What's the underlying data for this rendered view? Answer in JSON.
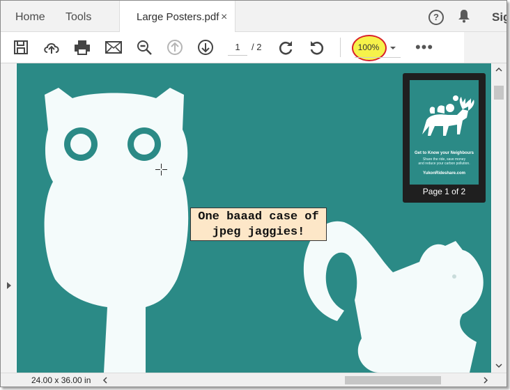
{
  "tabs": {
    "home": "Home",
    "tools": "Tools",
    "document": "Large Posters.pdf",
    "close_symbol": "×"
  },
  "header_right": {
    "help_symbol": "?",
    "signin_partial": "Sig"
  },
  "toolbar": {
    "page_current": "1",
    "page_total": "/ 2",
    "zoom": "100%",
    "more_symbol": "•••"
  },
  "thumbnail": {
    "headline": "Get to Know your Neighbours",
    "sub1": "Share the ride, save money",
    "sub2": "and reduce your carbon pollution.",
    "url": "YukonRideshare.com",
    "label": "Page 1 of 2"
  },
  "annotation": {
    "line1": "One baaad case of",
    "line2": "jpeg jaggies!"
  },
  "status": {
    "dimensions": "24.00 x 36.00 in"
  },
  "colors": {
    "poster_teal": "#2b8a86",
    "zoom_highlight": "#f6f24a",
    "zoom_ring": "#d8202a",
    "callout_bg": "#fde7c8"
  }
}
